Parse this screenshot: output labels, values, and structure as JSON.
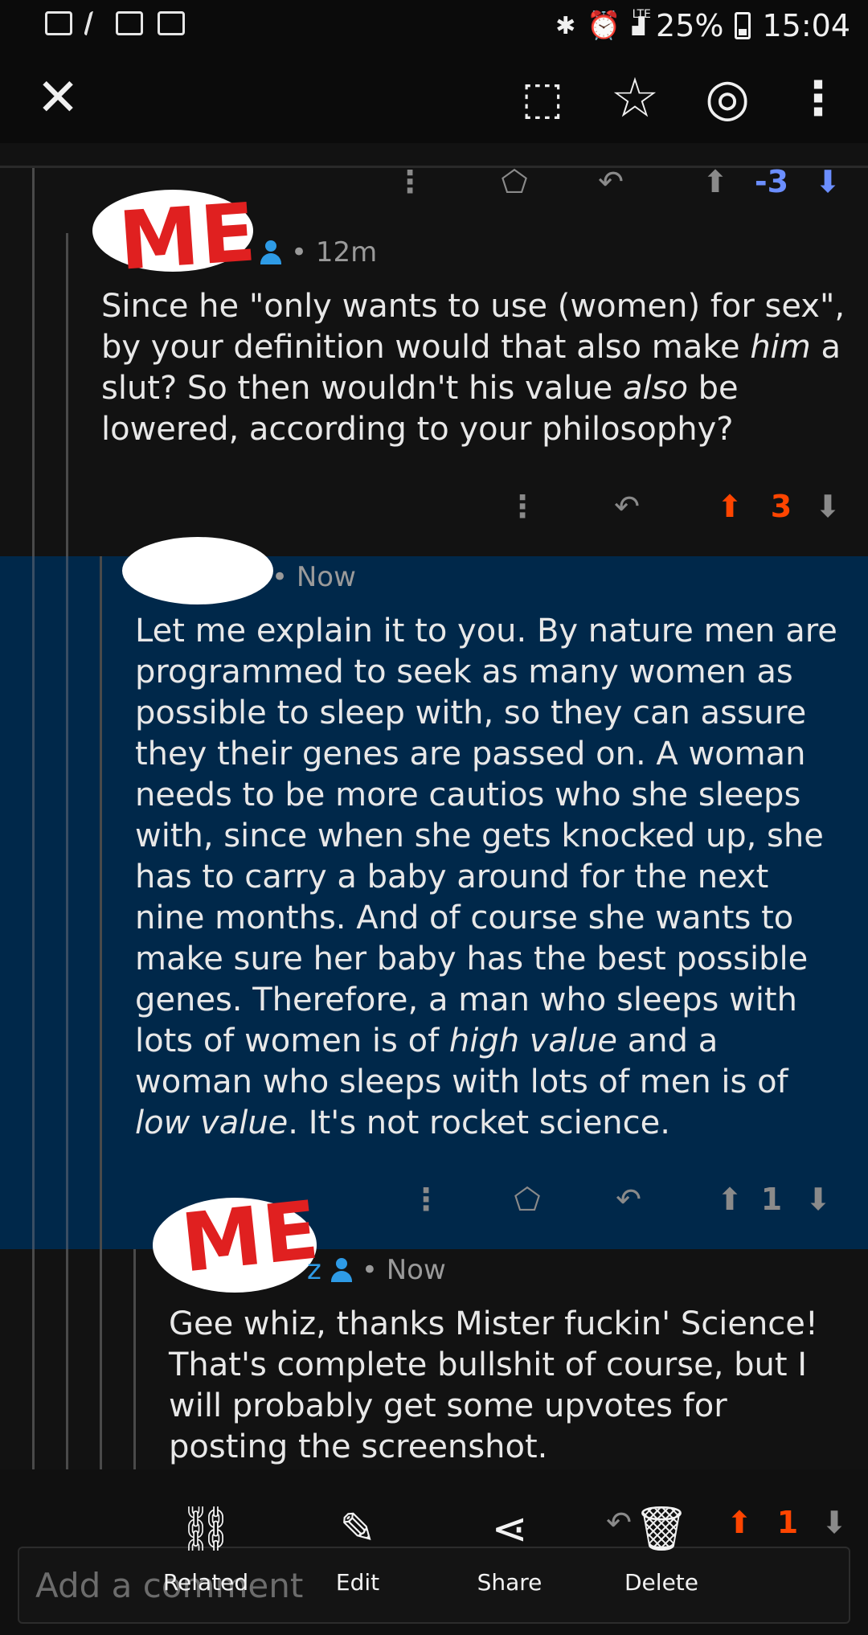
{
  "status_bar": {
    "battery": "25%",
    "time": "15:04",
    "network": "LTE",
    "left_icons": [
      "notification-icon",
      "pen-icon",
      "mail-icon",
      "image-icon"
    ],
    "right_icons": [
      "bluetooth-icon",
      "alarm-icon",
      "signal-icon",
      "battery-icon"
    ]
  },
  "toolbar": {
    "close": "✕",
    "scan": "⬚",
    "star": "☆",
    "screenshot": "◎",
    "more": "⋮"
  },
  "comments": [
    {
      "author_overlay": "ME",
      "age": "• 12m",
      "text_plain_1": "Since he \"only wants to use (women) for sex\", by your definition would that also make ",
      "text_em_1": "him",
      "text_plain_2": " a slut? So then wouldn't his value ",
      "text_em_2": "also",
      "text_plain_3": " be lowered, according to your philosophy?",
      "score": "3",
      "parent_score": "-3"
    },
    {
      "age": "• Now",
      "text_plain_1": "Let me explain it to you. By nature men are programmed to seek as many women as possible to sleep with, so they can assure they their genes are passed on. A woman needs to be more cautios who she sleeps with, since when she gets knocked up, she has to carry a baby around for the next nine months. And of course she wants to make sure her baby has the best possible genes. Therefore, a man who sleeps with lots of women is of ",
      "text_em_1": "high value",
      "text_plain_2": " and a woman who sleeps with lots of men is of ",
      "text_em_2": "low value",
      "text_plain_3": ". It's not rocket science.",
      "score": "1"
    },
    {
      "author_overlay": "ME",
      "author_partial": "z",
      "age": "• Now",
      "text": "Gee whiz, thanks Mister fuckin' Science! That's complete bullshit of course, but I will probably get some upvotes for posting the screenshot.",
      "score": "1"
    }
  ],
  "bottom_sheet": {
    "related": "Related",
    "edit": "Edit",
    "share": "Share",
    "delete": "Delete"
  },
  "comment_input": {
    "placeholder": "Add a comment"
  },
  "colors": {
    "upvote": "#ff4500",
    "downvote_active": "#6b8eff",
    "highlight": "#00284a",
    "user_blue": "#2e9be6"
  }
}
